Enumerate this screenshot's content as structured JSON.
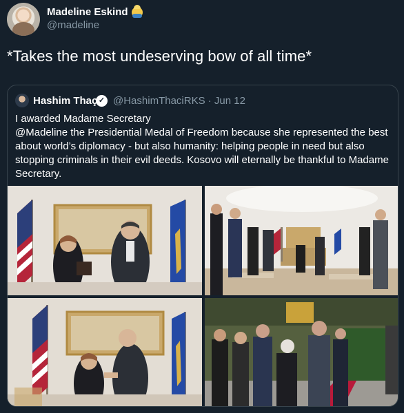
{
  "tweet": {
    "display_name": "Madeline Eskind",
    "handle": "@madeline",
    "text": "*Takes the most undeserving bow of all time*"
  },
  "quoted": {
    "display_name": "Hashim Thaçi",
    "meta": "@HashimThaciRKS · Jun 12",
    "line1": "I awarded Madame Secretary",
    "line2": "@Madeline the Presidential Medal of Freedom because she represented the best about world’s diplomacy - but also humanity: helping people in need but also stopping criminals in their evil deeds. Kosovo will eternally be thankful to Madame Secretary.",
    "verified_mark": "✓"
  },
  "colors": {
    "background": "#15202b",
    "secondary_text": "#8899a6",
    "border": "#38444d"
  },
  "icons": [
    "woman-emoji-icon",
    "verified-badge-icon"
  ]
}
